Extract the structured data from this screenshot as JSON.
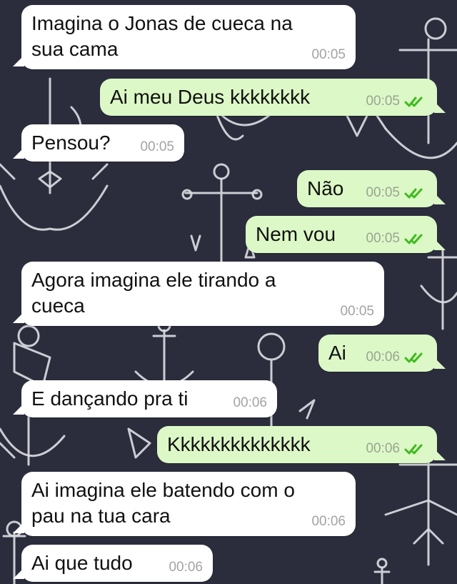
{
  "theme": {
    "background": "#2b2d3d",
    "incoming_bubble": "#ffffff",
    "outgoing_bubble": "#dcf8c6",
    "read_ticks": "#3fbb1f",
    "time_text": "#a3a3a3"
  },
  "wallpaper": {
    "motif": "anchor-pattern"
  },
  "messages": [
    {
      "direction": "in",
      "text": "Imagina o Jonas de cueca na\nsua cama",
      "time": "00:05"
    },
    {
      "direction": "out",
      "text": "Ai meu Deus kkkkkkkk",
      "time": "00:05",
      "status": "read-double-check"
    },
    {
      "direction": "in",
      "text": "Pensou?",
      "time": "00:05"
    },
    {
      "direction": "out",
      "text": "Não",
      "time": "00:05",
      "status": "read-double-check"
    },
    {
      "direction": "out",
      "text": "Nem vou",
      "time": "00:05",
      "status": "read-double-check"
    },
    {
      "direction": "in",
      "text": "Agora imagina ele tirando a\ncueca",
      "time": "00:05"
    },
    {
      "direction": "out",
      "text": "Ai",
      "time": "00:06",
      "status": "read-double-check"
    },
    {
      "direction": "in",
      "text": "E dançando pra ti",
      "time": "00:06"
    },
    {
      "direction": "out",
      "text": "Kkkkkkkkkkkkkk",
      "time": "00:06",
      "status": "read-double-check"
    },
    {
      "direction": "in",
      "text": "Ai imagina ele batendo com o\npau na tua cara",
      "time": "00:06"
    },
    {
      "direction": "in",
      "text": "Ai que tudo",
      "time": "00:06"
    }
  ]
}
